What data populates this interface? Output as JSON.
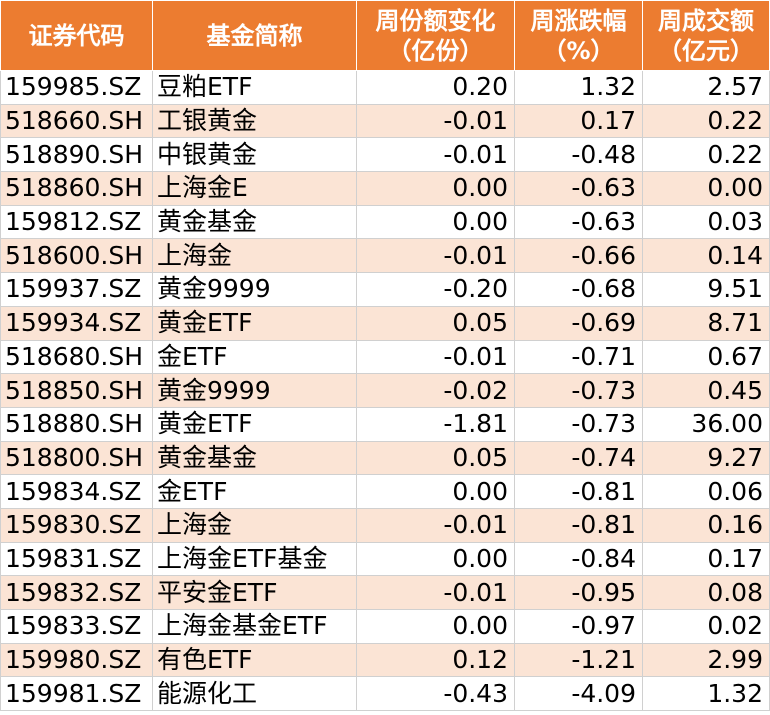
{
  "table": {
    "headers": [
      {
        "lines": [
          "证券代码"
        ]
      },
      {
        "lines": [
          "基金简称"
        ]
      },
      {
        "lines": [
          "周份额变化",
          "（亿份）"
        ]
      },
      {
        "lines": [
          "周涨跌幅",
          "（%）"
        ]
      },
      {
        "lines": [
          "周成交额",
          "（亿元）"
        ]
      }
    ],
    "rows": [
      [
        "159985.SZ",
        "豆粕ETF",
        "0.20",
        "1.32",
        "2.57"
      ],
      [
        "518660.SH",
        "工银黄金",
        "-0.01",
        "0.17",
        "0.22"
      ],
      [
        "518890.SH",
        "中银黄金",
        "-0.01",
        "-0.48",
        "0.22"
      ],
      [
        "518860.SH",
        "上海金E",
        "0.00",
        "-0.63",
        "0.00"
      ],
      [
        "159812.SZ",
        "黄金基金",
        "0.00",
        "-0.63",
        "0.03"
      ],
      [
        "518600.SH",
        "上海金",
        "-0.01",
        "-0.66",
        "0.14"
      ],
      [
        "159937.SZ",
        "黄金9999",
        "-0.20",
        "-0.68",
        "9.51"
      ],
      [
        "159934.SZ",
        "黄金ETF",
        "0.05",
        "-0.69",
        "8.71"
      ],
      [
        "518680.SH",
        "金ETF",
        "-0.01",
        "-0.71",
        "0.67"
      ],
      [
        "518850.SH",
        "黄金9999",
        "-0.02",
        "-0.73",
        "0.45"
      ],
      [
        "518880.SH",
        "黄金ETF",
        "-1.81",
        "-0.73",
        "36.00"
      ],
      [
        "518800.SH",
        "黄金基金",
        "0.05",
        "-0.74",
        "9.27"
      ],
      [
        "159834.SZ",
        "金ETF",
        "0.00",
        "-0.81",
        "0.06"
      ],
      [
        "159830.SZ",
        "上海金",
        "-0.01",
        "-0.81",
        "0.16"
      ],
      [
        "159831.SZ",
        "上海金ETF基金",
        "0.00",
        "-0.84",
        "0.17"
      ],
      [
        "159832.SZ",
        "平安金ETF",
        "-0.01",
        "-0.95",
        "0.08"
      ],
      [
        "159833.SZ",
        "上海金基金ETF",
        "0.00",
        "-0.97",
        "0.02"
      ],
      [
        "159980.SZ",
        "有色ETF",
        "0.12",
        "-1.21",
        "2.99"
      ],
      [
        "159981.SZ",
        "能源化工",
        "-0.43",
        "-4.09",
        "1.32"
      ]
    ]
  },
  "colors": {
    "header_bg": "#ec7c30",
    "header_text": "#ffffff",
    "row_alt_bg": "#fbe4d5",
    "row_bg": "#ffffff"
  }
}
